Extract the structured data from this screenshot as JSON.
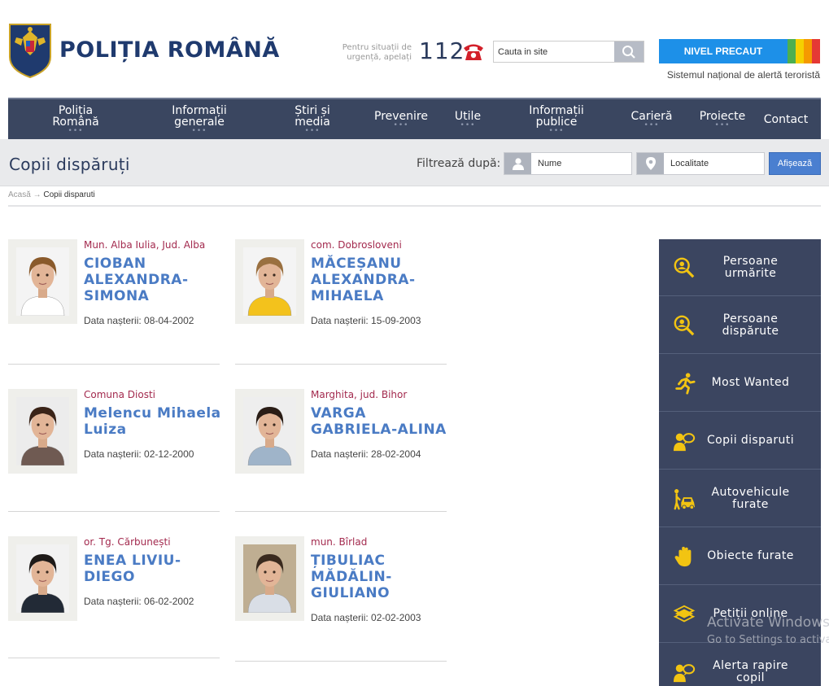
{
  "header": {
    "brand": "POLIȚIA ROMÂNĂ",
    "emergency_line1": "Pentru situații de",
    "emergency_line2": "urgență, apelați",
    "emergency_number": "112",
    "search_placeholder": "Cauta in site",
    "alert_level": "NIVEL PRECAUT",
    "alert_caption": "Sistemul național de alertă teroristă",
    "alert_colors": [
      "#4caf50",
      "#f5d000",
      "#f59a00",
      "#e53935"
    ]
  },
  "nav": [
    {
      "line1": "Poliția",
      "line2": "Română"
    },
    {
      "line1": "Informații",
      "line2": "generale"
    },
    {
      "line1": "Știri și",
      "line2": "media"
    },
    {
      "line1": "Prevenire",
      "line2": ""
    },
    {
      "line1": "Utile",
      "line2": ""
    },
    {
      "line1": "Informații",
      "line2": "publice"
    },
    {
      "line1": "Carieră",
      "line2": ""
    },
    {
      "line1": "Proiecte",
      "line2": ""
    },
    {
      "line1": "Contact",
      "line2": ""
    }
  ],
  "page": {
    "title": "Copii dispăruți",
    "filter_label": "Filtrează după:",
    "name_placeholder": "Nume",
    "city_placeholder": "Localitate",
    "show_button": "Afișează"
  },
  "breadcrumb": {
    "home": "Acasă",
    "separator": "→",
    "current": "Copii disparuti"
  },
  "persons": [
    {
      "location": "Mun. Alba Iulia, Jud. Alba",
      "name": "CIOBAN ALEXANDRA-SIMONA",
      "dob": "Data nașterii: 08-04-2002"
    },
    {
      "location": "com. Dobrosloveni",
      "name": "MĂCEȘANU ALEXANDRA-MIHAELA",
      "dob": "Data nașterii: 15-09-2003"
    },
    {
      "location": "Comuna Diosti",
      "name": "Melencu Mihaela Luiza",
      "dob": "Data nașterii: 02-12-2000"
    },
    {
      "location": "Marghita, jud. Bihor",
      "name": "VARGA GABRIELA-ALINA",
      "dob": "Data nașterii: 28-02-2004"
    },
    {
      "location": "or. Tg. Cărbunești",
      "name": "ENEA LIVIU-DIEGO",
      "dob": "Data nașterii: 06-02-2002"
    },
    {
      "location": "mun. Bîrlad",
      "name": "ȚIBULIAC MĂDĂLIN-GIULIANO",
      "dob": "Data nașterii: 02-02-2003"
    }
  ],
  "sidebar": [
    {
      "line1": "Persoane",
      "line2": "urmărite",
      "icon": "search-person-icon"
    },
    {
      "line1": "Persoane",
      "line2": "dispărute",
      "icon": "search-person-icon"
    },
    {
      "line1": "Most Wanted",
      "line2": "",
      "icon": "running-man-icon"
    },
    {
      "line1": "Copii disparuti",
      "line2": "",
      "icon": "child-icon"
    },
    {
      "line1": "Autovehicule",
      "line2": "furate",
      "icon": "car-icon"
    },
    {
      "line1": "Obiecte furate",
      "line2": "",
      "icon": "hand-icon"
    },
    {
      "line1": "Petiții online",
      "line2": "",
      "icon": "documents-icon"
    },
    {
      "line1": "Alerta rapire",
      "line2": "copil",
      "icon": "child-icon"
    }
  ],
  "watermark": {
    "line1": "Activate Windows",
    "line2": "Go to Settings to activate Windows."
  }
}
